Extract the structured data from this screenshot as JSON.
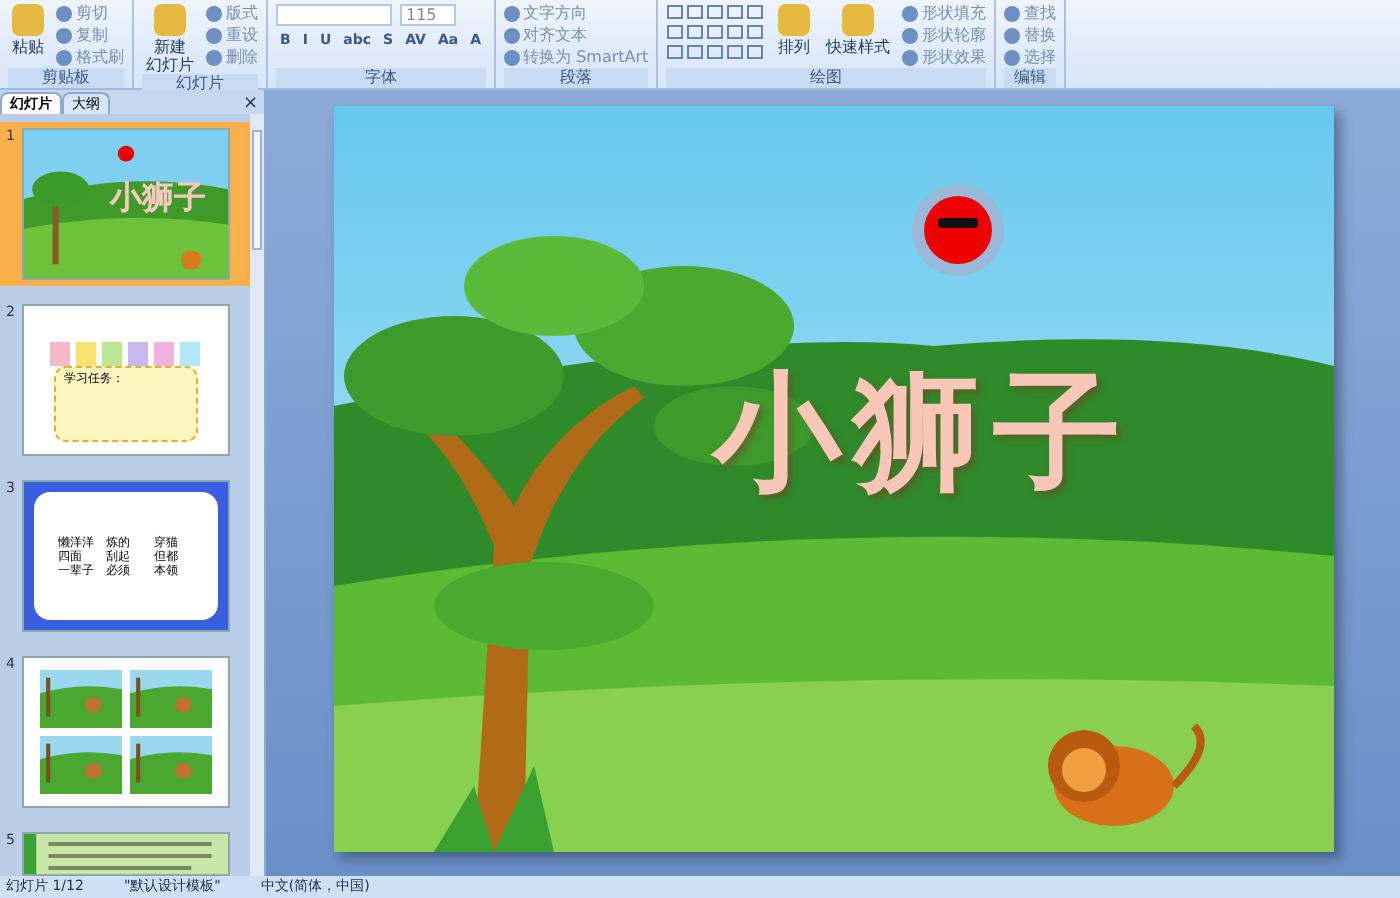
{
  "ribbon": {
    "groups": [
      {
        "label": "剪贴板",
        "buttons": [
          {
            "label": "粘贴",
            "kind": "large"
          },
          {
            "label": "剪切",
            "kind": "small"
          },
          {
            "label": "复制",
            "kind": "small"
          },
          {
            "label": "格式刷",
            "kind": "small"
          }
        ]
      },
      {
        "label": "幻灯片",
        "buttons": [
          {
            "lines": [
              "新建",
              "幻灯片"
            ],
            "kind": "large"
          },
          {
            "label": "版式",
            "kind": "small"
          },
          {
            "label": "重设",
            "kind": "small"
          },
          {
            "label": "删除",
            "kind": "small"
          }
        ]
      },
      {
        "label": "字体",
        "font_size": "115",
        "font_buttons": [
          "B",
          "I",
          "U",
          "abc",
          "S",
          "AV",
          "Aa",
          "A"
        ]
      },
      {
        "label": "段落",
        "buttons": [
          {
            "label": "文字方向",
            "kind": "small"
          },
          {
            "label": "对齐文本",
            "kind": "small"
          },
          {
            "label": "转换为 SmartArt",
            "kind": "small"
          }
        ]
      },
      {
        "label": "绘图",
        "buttons": [
          {
            "label": "排列",
            "kind": "large"
          },
          {
            "label": "快速样式",
            "kind": "large"
          },
          {
            "label": "形状填充",
            "kind": "small"
          },
          {
            "label": "形状轮廓",
            "kind": "small"
          },
          {
            "label": "形状效果",
            "kind": "small"
          }
        ]
      },
      {
        "label": "编辑",
        "buttons": [
          {
            "label": "查找",
            "kind": "small"
          },
          {
            "label": "替换",
            "kind": "small"
          },
          {
            "label": "选择",
            "kind": "small"
          }
        ]
      }
    ]
  },
  "panel_tabs": [
    {
      "label": "幻灯片",
      "selected": true
    },
    {
      "label": "大纲",
      "selected": false
    }
  ],
  "panel_close": "×",
  "thumbnails": [
    {
      "number": "1",
      "kind": "title",
      "selected": true,
      "title": "小狮子"
    },
    {
      "number": "2",
      "kind": "pencils",
      "selected": false,
      "title": "学习任务："
    },
    {
      "number": "3",
      "kind": "words",
      "selected": false,
      "words": [
        "懒洋洋",
        "炼的",
        "穿猫",
        "四面",
        "刮起",
        "但都",
        "一辈子",
        "必须",
        "本领"
      ]
    },
    {
      "number": "4",
      "kind": "scenes",
      "selected": false
    },
    {
      "number": "5",
      "kind": "text",
      "selected": false
    }
  ],
  "slide": {
    "title": "小狮子"
  },
  "status_bar": {
    "slide": "幻灯片 1/12",
    "theme": "\"默认设计模板\"",
    "language": "中文(简体，中国)"
  }
}
